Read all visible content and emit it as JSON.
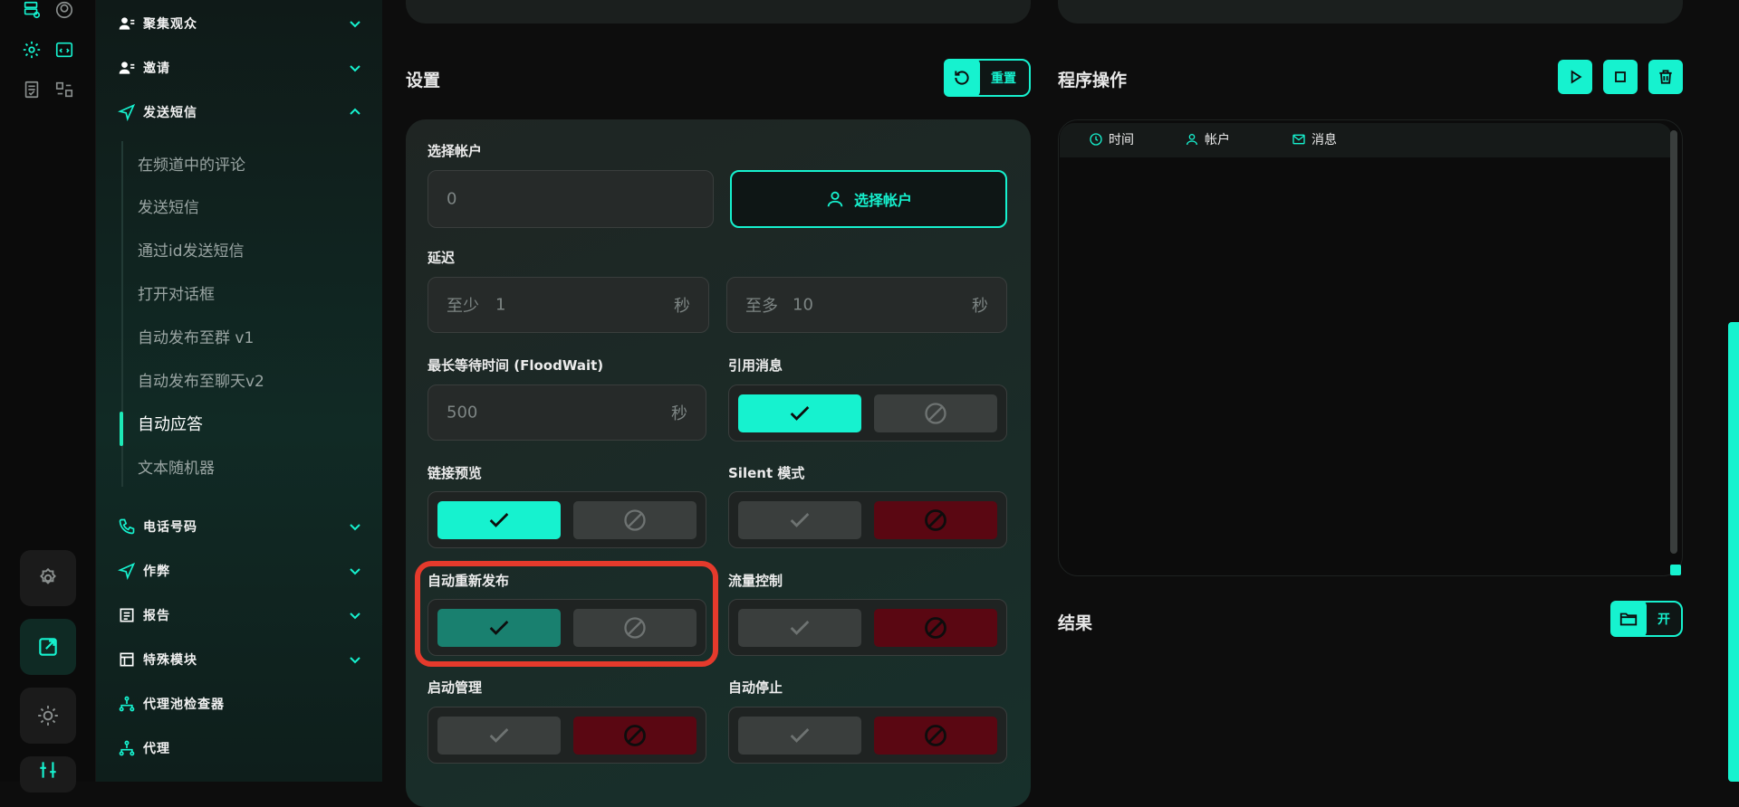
{
  "colors": {
    "accent": "#16f2cf",
    "danger": "#5a0712",
    "highlight": "#e53a2c"
  },
  "sidebar": {
    "groups": [
      {
        "label": "聚集观众",
        "icon": "users-icon"
      },
      {
        "label": "邀请",
        "icon": "user-add-icon"
      },
      {
        "label": "发送短信",
        "icon": "send-icon"
      },
      {
        "label": "电话号码",
        "icon": "phone-icon"
      },
      {
        "label": "作弊",
        "icon": "send-check-icon"
      },
      {
        "label": "报告",
        "icon": "report-icon"
      },
      {
        "label": "特殊模块",
        "icon": "module-icon"
      },
      {
        "label": "代理池检查器",
        "icon": "network-icon"
      },
      {
        "label": "代理",
        "icon": "network-icon"
      }
    ],
    "sub_items": [
      "在频道中的评论",
      "发送短信",
      "通过id发送短信",
      "打开对话框",
      "自动发布至群 v1",
      "自动发布至聊天v2",
      "自动应答",
      "文本随机器"
    ],
    "active_sub_item": "自动应答"
  },
  "settings": {
    "title": "设置",
    "reset_label": "重置",
    "select_account": {
      "label": "选择帐户",
      "value": "0",
      "button": "选择帐户"
    },
    "delay": {
      "label": "延迟",
      "min_prefix": "至少",
      "min_value": "1",
      "max_prefix": "至多",
      "max_value": "10",
      "unit": "秒"
    },
    "floodwait": {
      "label": "最长等待时间 (FloodWait)",
      "value": "500",
      "unit": "秒"
    },
    "toggles": {
      "quote": {
        "label": "引用消息",
        "state": "on"
      },
      "link_preview": {
        "label": "链接预览",
        "state": "on"
      },
      "silent": {
        "label": "Silent 模式",
        "state": "off"
      },
      "auto_repost": {
        "label": "自动重新发布",
        "state": "on"
      },
      "flow_control": {
        "label": "流量控制",
        "state": "off"
      },
      "auto_manage": {
        "label": "启动管理",
        "state": "off"
      },
      "auto_stop": {
        "label": "自动停止",
        "state": "off"
      }
    }
  },
  "operations": {
    "title": "程序操作",
    "columns": [
      "时间",
      "帐户",
      "消息"
    ]
  },
  "results": {
    "title": "结果",
    "open_label": "开"
  }
}
